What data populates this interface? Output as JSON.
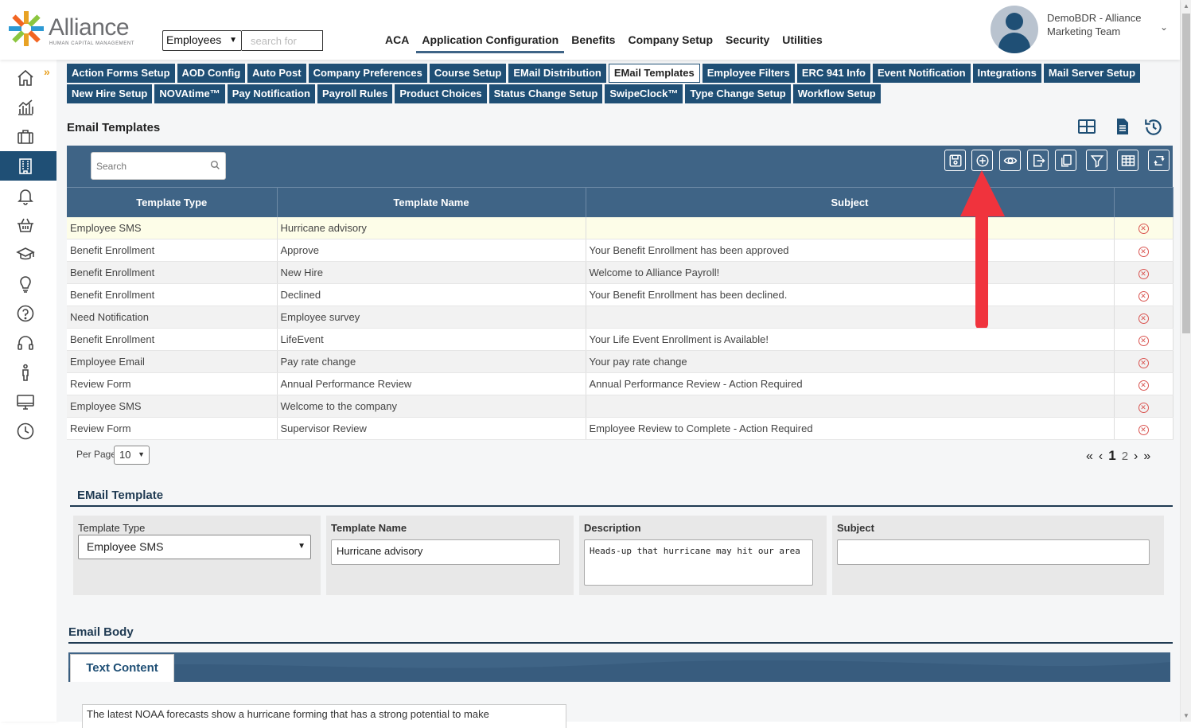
{
  "header": {
    "logo_text": "Alliance",
    "logo_subtitle": "HUMAN CAPITAL MANAGEMENT",
    "search_scope": "Employees",
    "search_placeholder": "search for",
    "nav": [
      "ACA",
      "Application Configuration",
      "Benefits",
      "Company Setup",
      "Security",
      "Utilities"
    ],
    "active_nav": "Application Configuration",
    "user_line1": "DemoBDR - Alliance",
    "user_line2": "Marketing Team"
  },
  "sidebar": {
    "items": [
      "home-icon",
      "analytics-icon",
      "briefcase-icon",
      "building-icon",
      "bell-icon",
      "basket-icon",
      "graduation-cap-icon",
      "lightbulb-icon",
      "help-icon",
      "headset-icon",
      "person-icon",
      "monitor-icon",
      "clock-icon"
    ],
    "active": "building-icon"
  },
  "tabs": {
    "row1": [
      "Action Forms Setup",
      "AOD Config",
      "Auto Post",
      "Company Preferences",
      "Course Setup",
      "EMail Distribution",
      "EMail Templates",
      "Employee Filters",
      "ERC 941 Info",
      "Event Notification",
      "Integrations",
      "Mail Server Setup"
    ],
    "row2": [
      "New Hire Setup",
      "NOVAtime™",
      "Pay Notification",
      "Payroll Rules",
      "Product Choices",
      "Status Change Setup",
      "SwipeClock™",
      "Type Change Setup",
      "Workflow Setup"
    ],
    "active": "EMail Templates"
  },
  "grid": {
    "title": "Email Templates",
    "search_placeholder": "Search",
    "toolbar": [
      "save-icon",
      "add-icon",
      "view-icon",
      "export-icon",
      "copy-icon",
      "filter-icon",
      "columns-icon",
      "refresh-icon"
    ],
    "columns": [
      "Template Type",
      "Template Name",
      "Subject"
    ],
    "rows": [
      [
        "Employee SMS",
        "Hurricane advisory",
        ""
      ],
      [
        "Benefit Enrollment",
        "Approve",
        "Your Benefit Enrollment has been approved"
      ],
      [
        "Benefit Enrollment",
        "New Hire",
        "Welcome to Alliance Payroll!"
      ],
      [
        "Benefit Enrollment",
        "Declined",
        "Your Benefit Enrollment has been declined."
      ],
      [
        "Need Notification",
        "Employee survey",
        ""
      ],
      [
        "Benefit Enrollment",
        "LifeEvent",
        "Your Life Event Enrollment is Available!"
      ],
      [
        "Employee Email",
        "Pay rate change",
        "Your pay rate change"
      ],
      [
        "Review Form",
        "Annual Performance Review",
        "Annual Performance Review - Action Required"
      ],
      [
        "Employee SMS",
        "Welcome to the company",
        ""
      ],
      [
        "Review Form",
        "Supervisor Review",
        "Employee Review to Complete - Action Required"
      ]
    ],
    "per_page_label": "Per Page",
    "per_page": "10",
    "pages": [
      "1",
      "2"
    ],
    "current_page": "1"
  },
  "form": {
    "title": "EMail Template",
    "template_type_label": "Template Type",
    "template_type_value": "Employee SMS",
    "template_name_label": "Template Name",
    "template_name_value": "Hurricane advisory",
    "description_label": "Description",
    "description_value": "Heads-up that hurricane may hit our area",
    "subject_label": "Subject",
    "subject_value": ""
  },
  "email_body": {
    "title": "Email Body",
    "tab": "Text Content",
    "text": "The latest NOAA forecasts show a hurricane forming that has a strong potential to make"
  },
  "colors": {
    "brand_navy": "#1f4f75",
    "grid_header": "#3f6486",
    "annotation_arrow": "#f0333d",
    "delete_red": "#d9534f"
  }
}
